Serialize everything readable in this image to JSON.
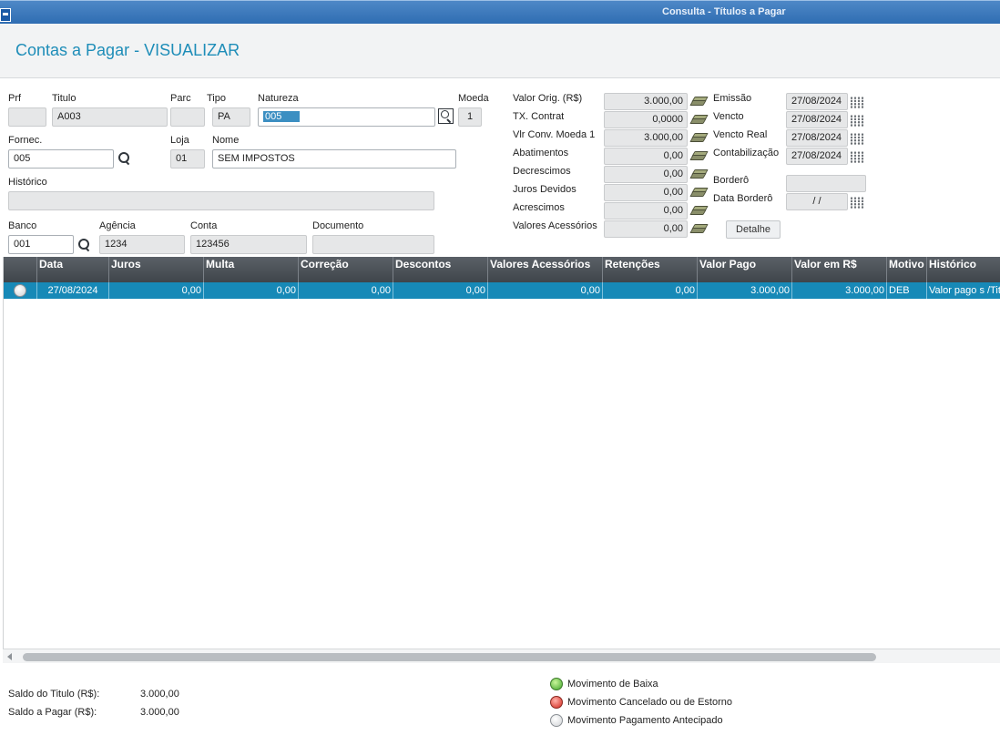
{
  "window": {
    "title": "Consulta - Títulos a Pagar"
  },
  "page": {
    "title": "Contas a Pagar - VISUALIZAR"
  },
  "form": {
    "prf": {
      "label": "Prf",
      "value": ""
    },
    "titulo": {
      "label": "Titulo",
      "value": "A003"
    },
    "parc": {
      "label": "Parc",
      "value": ""
    },
    "tipo": {
      "label": "Tipo",
      "value": "PA"
    },
    "natureza": {
      "label": "Natureza",
      "value": "005"
    },
    "moeda": {
      "label": "Moeda",
      "value": "1"
    },
    "fornec": {
      "label": "Fornec.",
      "value": "005"
    },
    "loja": {
      "label": "Loja",
      "value": "01"
    },
    "nome": {
      "label": "Nome",
      "value": "SEM IMPOSTOS"
    },
    "historico": {
      "label": "Histórico",
      "value": ""
    },
    "banco": {
      "label": "Banco",
      "value": "001"
    },
    "agencia": {
      "label": "Agência",
      "value": "1234"
    },
    "conta": {
      "label": "Conta",
      "value": "123456"
    },
    "documento": {
      "label": "Documento",
      "value": ""
    }
  },
  "values": [
    {
      "label": "Valor Orig. (R$)",
      "value": "3.000,00"
    },
    {
      "label": "TX. Contrat",
      "value": "0,0000"
    },
    {
      "label": "Vlr Conv. Moeda 1",
      "value": "3.000,00"
    },
    {
      "label": "Abatimentos",
      "value": "0,00"
    },
    {
      "label": "Decrescimos",
      "value": "0,00"
    },
    {
      "label": "Juros Devidos",
      "value": "0,00"
    },
    {
      "label": "Acrescimos",
      "value": "0,00"
    },
    {
      "label": "Valores Acessórios",
      "value": "0,00"
    }
  ],
  "dates": [
    {
      "label": "Emissão",
      "value": "27/08/2024"
    },
    {
      "label": "Vencto",
      "value": "27/08/2024"
    },
    {
      "label": "Vencto Real",
      "value": "27/08/2024"
    },
    {
      "label": "Contabilização",
      "value": "27/08/2024"
    }
  ],
  "bordero": {
    "label": "Borderô",
    "value": ""
  },
  "data_bordero": {
    "label": "Data Borderô",
    "value": " / /"
  },
  "detalhe_button": "Detalhe",
  "grid": {
    "columns": [
      "",
      "Data",
      "Juros",
      "Multa",
      "Correção",
      "Descontos",
      "Valores Acessórios",
      "Retenções",
      "Valor Pago",
      "Valor em R$",
      "Motivo",
      "Histórico"
    ],
    "rows": [
      {
        "status": "Movimento Pagamento Antecipado",
        "data": "27/08/2024",
        "juros": "0,00",
        "multa": "0,00",
        "correcao": "0,00",
        "descontos": "0,00",
        "valores_acessorios": "0,00",
        "retencoes": "0,00",
        "valor_pago": "3.000,00",
        "valor_rs": "3.000,00",
        "motivo": "DEB",
        "historico": "Valor pago s /Titu"
      }
    ]
  },
  "footer": {
    "saldo_titulo": {
      "label": "Saldo do Titulo (R$):",
      "value": "3.000,00"
    },
    "saldo_pagar": {
      "label": "Saldo a Pagar (R$):",
      "value": "3.000,00"
    }
  },
  "legend": [
    {
      "label": "Movimento de Baixa",
      "color": "#3fa52a"
    },
    {
      "label": "Movimento Cancelado ou de Estorno",
      "color": "#d1261c"
    },
    {
      "label": "Movimento Pagamento Antecipado",
      "color": "#e8e9ea"
    }
  ]
}
